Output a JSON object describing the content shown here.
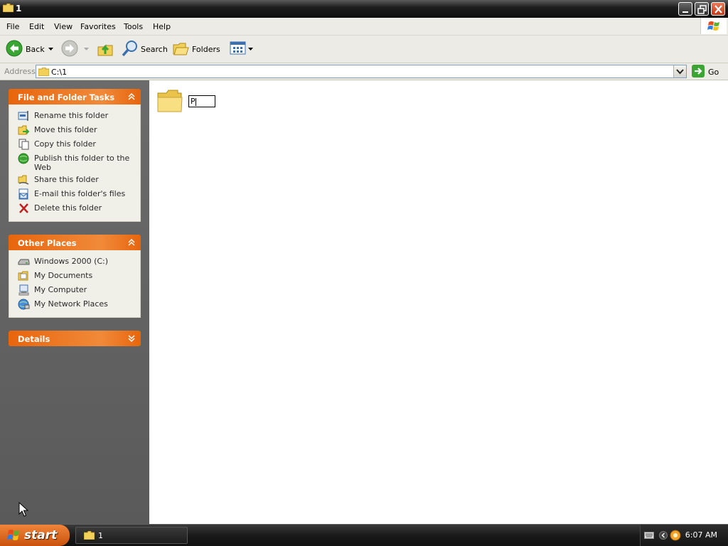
{
  "window": {
    "title": "1"
  },
  "menubar": {
    "items": [
      "File",
      "Edit",
      "View",
      "Favorites",
      "Tools",
      "Help"
    ]
  },
  "toolbar": {
    "back_label": "Back",
    "search_label": "Search",
    "folders_label": "Folders"
  },
  "address": {
    "label": "Address",
    "value": "C:\\1",
    "go_label": "Go"
  },
  "panels": {
    "tasks": {
      "title": "File and Folder Tasks",
      "items": [
        "Rename this folder",
        "Move this folder",
        "Copy this folder",
        "Publish this folder to the Web",
        "Share this folder",
        "E-mail this folder's files",
        "Delete this folder"
      ]
    },
    "places": {
      "title": "Other Places",
      "items": [
        "Windows 2000 (C:)",
        "My Documents",
        "My Computer",
        "My Network Places"
      ]
    },
    "details": {
      "title": "Details"
    }
  },
  "content": {
    "rename_value": "P"
  },
  "taskbar": {
    "start_label": "start",
    "task_label": "1",
    "clock": "6:07 AM"
  },
  "colors": {
    "panel_header": "#e8650c",
    "pane_background": "#5f5f5f",
    "titlebar": "#1e1e1e"
  }
}
